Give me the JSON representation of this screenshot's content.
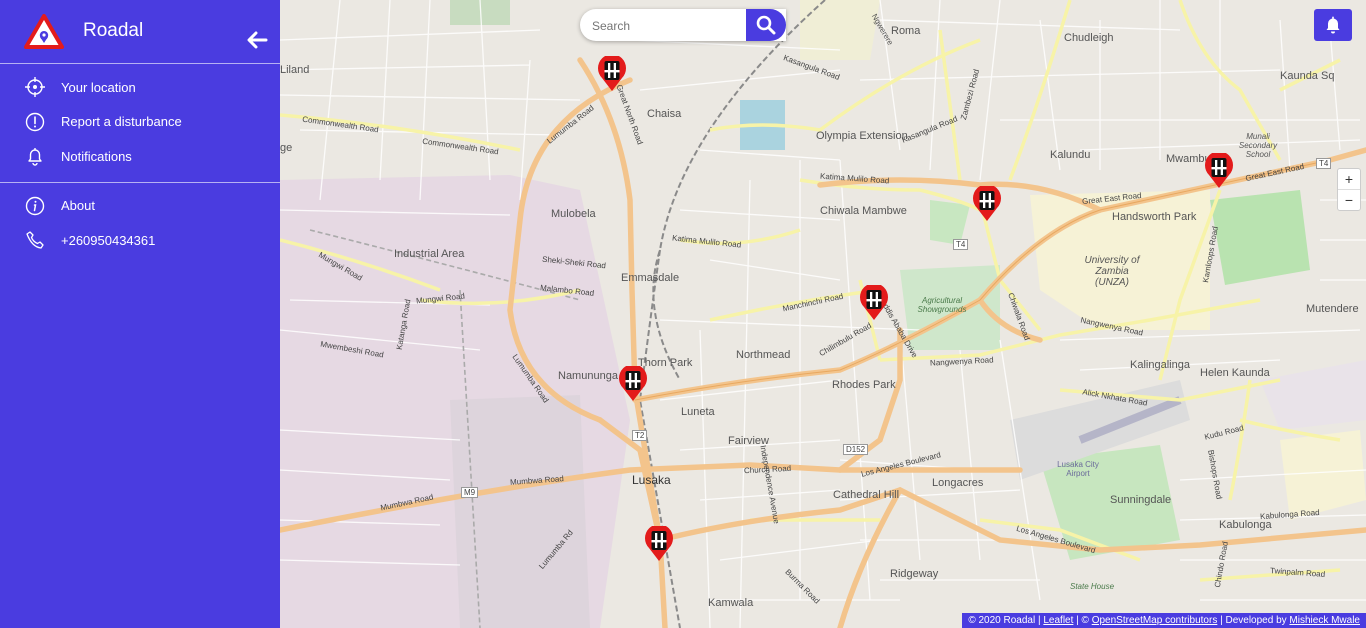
{
  "app": {
    "title": "Roadal"
  },
  "menu": {
    "items": [
      {
        "label": "Your location",
        "icon": "crosshair-icon"
      },
      {
        "label": "Report a disturbance",
        "icon": "alert-circle-icon"
      },
      {
        "label": "Notifications",
        "icon": "bell-icon"
      }
    ],
    "secondary": [
      {
        "label": "About",
        "icon": "info-icon"
      },
      {
        "label": "+260950434361",
        "icon": "phone-icon"
      }
    ]
  },
  "search": {
    "placeholder": "Search"
  },
  "zoom": {
    "in": "+",
    "out": "−"
  },
  "map": {
    "places": [
      "Roma",
      "Ngwerere",
      "Chudleigh",
      "Kaunda Sq",
      "Liland",
      "Chaisa",
      "Olympia Extension",
      "Kalundu",
      "Mwambu",
      "Munali Secondary School",
      "Mulobela",
      "Chiwala Mambwe",
      "Handsworth Park",
      "Industrial Area",
      "Emmasdale",
      "University of Zambia (UNZA)",
      "Agricultural Showgrounds",
      "Mutendere",
      "Northmead",
      "Thorn Park",
      "Namununga",
      "Rhodes Park",
      "Kalingalinga",
      "Helen Kaunda",
      "Luneta",
      "Fairview",
      "Lusaka",
      "Cathedral Hill",
      "Longacres",
      "Lusaka City Airport",
      "Sunningdale",
      "Kabulonga",
      "Ridgeway",
      "State House",
      "Kamwala",
      "ge"
    ],
    "roads": [
      "Commonwealth Road",
      "Lumumba Road",
      "Great North Road",
      "Kasangula Road",
      "Great East Road",
      "Katima Mulilo Road",
      "Sheki-Sheki Road",
      "Malambo Road",
      "Mungwi Road",
      "Mumbwa Road",
      "Church Road",
      "Los Angeles Boulevard",
      "Nangwenya Road",
      "Alick Nkhata Road",
      "Kudu Road",
      "Manchinchi Road",
      "Addis Ababa Drive",
      "Chilimbulu Road",
      "Burma Road",
      "Independence Avenue",
      "Kabulonga Road",
      "Twinpalm Road",
      "Bishops Road",
      "Chindo Road",
      "Mwembeshi Road",
      "Katanga Road",
      "Kamloops Road",
      "Zambezi Road",
      "Chiwala Road",
      "Lumumba Rd"
    ],
    "shields": [
      "T4",
      "T2",
      "M9",
      "D152"
    ]
  },
  "markers": [
    "disturbance-1",
    "disturbance-2",
    "disturbance-3",
    "disturbance-4",
    "disturbance-5",
    "disturbance-6"
  ],
  "attribution": {
    "prefix": "© 2020 Roadal | ",
    "leaflet": "Leaflet",
    "mid": " | © ",
    "osm": "OpenStreetMap contributors",
    "dev_prefix": " | Developed by ",
    "dev": "Mishieck Mwale"
  },
  "colors": {
    "accent": "#4a3ce0",
    "marker": "#e31b1b"
  }
}
